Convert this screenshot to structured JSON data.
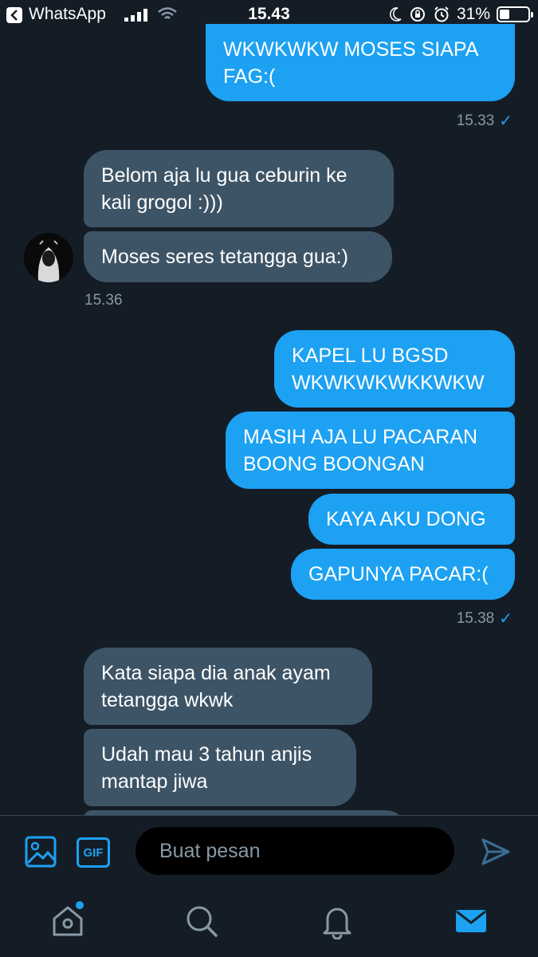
{
  "status_bar": {
    "back_app": "WhatsApp",
    "time": "15.43",
    "battery": "31%",
    "battery_level": 0.31
  },
  "messages": [
    {
      "dir": "out",
      "text": "WKWKWKW MOSES SIAPA\nFAG:("
    },
    {
      "ts": "15.33",
      "read": true
    },
    {
      "dir": "in",
      "text": "Belom aja lu gua ceburin ke\nkali grogol :)))"
    },
    {
      "dir": "in",
      "text": "Moses seres tetangga gua:)"
    },
    {
      "ts": "15.36"
    },
    {
      "dir": "out",
      "text": "KAPEL LU BGSD\nWKWKWKWKKWKW"
    },
    {
      "dir": "out",
      "text": "MASIH AJA LU PACARAN\nBOONG BOONGAN"
    },
    {
      "dir": "out",
      "text": "KAYA AKU DONG"
    },
    {
      "dir": "out",
      "text": "GAPUNYA PACAR:("
    },
    {
      "ts": "15.38",
      "read": true
    },
    {
      "dir": "in",
      "text": "Kata siapa dia anak ayam\ntetangga wkwk"
    },
    {
      "dir": "in",
      "text": "Udah mau 3 tahun anjis\nmantap jiwa"
    }
  ],
  "composer": {
    "placeholder": "Buat pesan",
    "gif_label": "GIF"
  },
  "icons": {
    "image": "image-icon",
    "gif": "gif-icon",
    "send": "send-icon",
    "home": "home-icon",
    "search": "search-icon",
    "notifications": "bell-icon",
    "messages": "mail-icon"
  },
  "colors": {
    "background": "#141d26",
    "outgoing_bubble": "#1da1f2",
    "incoming_bubble": "#3d5466",
    "accent": "#1da1f2",
    "muted_text": "#8899a6"
  }
}
